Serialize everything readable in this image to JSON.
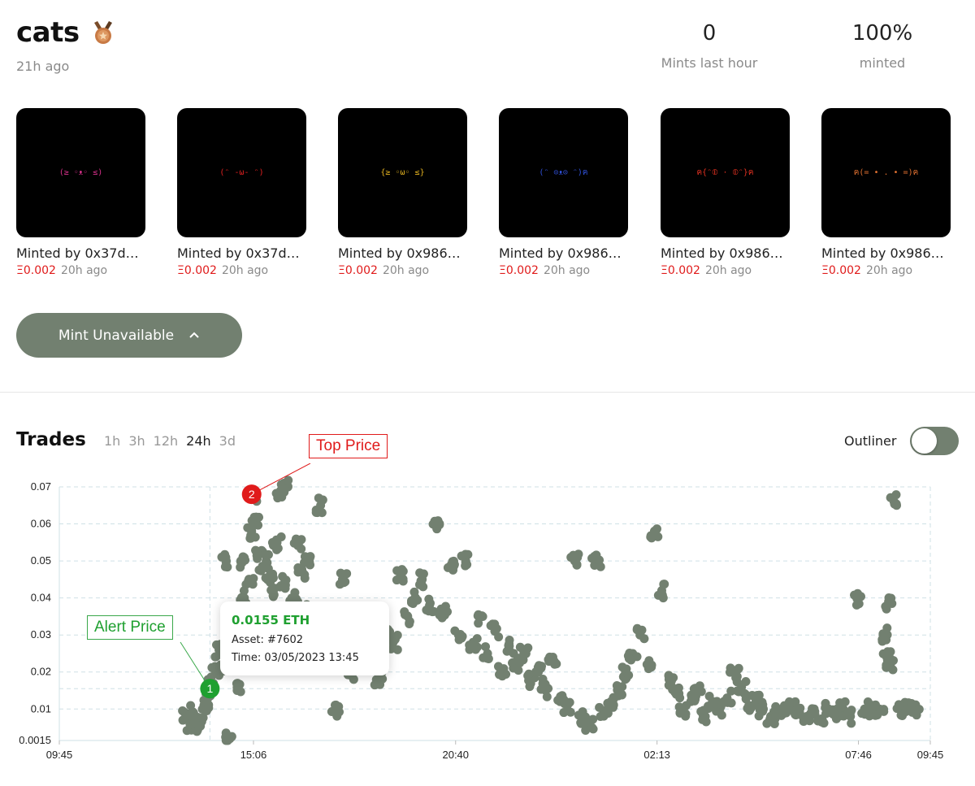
{
  "collection": {
    "name": "cats",
    "created": "21h ago",
    "medal_icon": "bronze-medal-icon"
  },
  "stats": [
    {
      "value": "0",
      "label": "Mints last hour"
    },
    {
      "value": "100%",
      "label": "minted"
    }
  ],
  "mints": [
    {
      "face": "(≥ ◦ᴥ◦ ≤)",
      "face_color": "#d6308a",
      "minted_by": "Minted by 0x37d4...",
      "price": "Ξ0.002",
      "time": "20h ago"
    },
    {
      "face": "(ᵔ -ω- ᵔ)",
      "face_color": "#e02020",
      "minted_by": "Minted by 0x37d4...",
      "price": "Ξ0.002",
      "time": "20h ago"
    },
    {
      "face": "{≥ ◦ω◦ ≤}",
      "face_color": "#e0b020",
      "minted_by": "Minted by 0x9860...",
      "price": "Ξ0.002",
      "time": "20h ago"
    },
    {
      "face": "(ᵔ ⊙ᴥ⊙ ᵔ)ฅ",
      "face_color": "#3050d8",
      "minted_by": "Minted by 0x9860...",
      "price": "Ξ0.002",
      "time": "20h ago"
    },
    {
      "face": "ฅ{ᵔ⦶ · ⦶ᵔ}ฅ",
      "face_color": "#e03020",
      "minted_by": "Minted by 0x9860...",
      "price": "Ξ0.002",
      "time": "20h ago"
    },
    {
      "face": "ฅ(= • . • =)ฅ",
      "face_color": "#e07030",
      "minted_by": "Minted by 0x9860...",
      "price": "Ξ0.002",
      "time": "20h ago"
    }
  ],
  "mint_button": {
    "label": "Mint Unavailable",
    "icon": "chevron-up-icon"
  },
  "trades": {
    "title": "Trades",
    "ranges": [
      "1h",
      "3h",
      "12h",
      "24h",
      "3d"
    ],
    "active_range": "24h",
    "outliner_label": "Outliner",
    "outliner_on": true
  },
  "tooltip": {
    "price": "0.0155 ETH",
    "asset": "Asset: #7602",
    "time": "Time: 03/05/2023 13:45"
  },
  "callouts": {
    "top_price": "Top Price",
    "alert_price": "Alert Price"
  },
  "markers": {
    "one": {
      "label": "1",
      "x_hours": 4.15,
      "y": 0.0155,
      "color": "#1fa030"
    },
    "two": {
      "label": "2",
      "x_hours": 5.3,
      "y": 0.068,
      "color": "#e01b1b"
    }
  },
  "chart_data": {
    "type": "scatter",
    "title": "",
    "xlabel": "",
    "ylabel": "",
    "x_unit": "hours since 09:45",
    "xlim": [
      0,
      24
    ],
    "ylim": [
      0.0015,
      0.07
    ],
    "x_tick_labels": [
      {
        "at": 0,
        "label": "09:45"
      },
      {
        "at": 5.35,
        "label": "15:06"
      },
      {
        "at": 10.92,
        "label": "20:40"
      },
      {
        "at": 16.47,
        "label": "02:13"
      },
      {
        "at": 22.02,
        "label": "07:46"
      },
      {
        "at": 24,
        "label": "09:45"
      }
    ],
    "y_ticks": [
      0.0015,
      0.01,
      0.02,
      0.03,
      0.04,
      0.05,
      0.06,
      0.07
    ],
    "y_tick_labels": [
      "0.0015",
      "0.01",
      "0.02",
      "0.03",
      "0.04",
      "0.05",
      "0.06",
      "0.07"
    ],
    "grid": true,
    "color": "#728070",
    "points": [
      [
        3.5,
        0.008
      ],
      [
        3.6,
        0.006
      ],
      [
        3.7,
        0.009
      ],
      [
        3.8,
        0.005
      ],
      [
        3.9,
        0.007
      ],
      [
        4.0,
        0.011
      ],
      [
        4.1,
        0.013
      ],
      [
        4.2,
        0.016
      ],
      [
        4.3,
        0.02
      ],
      [
        4.4,
        0.026
      ],
      [
        4.5,
        0.022
      ],
      [
        4.6,
        0.05
      ],
      [
        4.7,
        0.002
      ],
      [
        4.8,
        0.025
      ],
      [
        4.9,
        0.015
      ],
      [
        5.0,
        0.05
      ],
      [
        5.1,
        0.04
      ],
      [
        5.2,
        0.033
      ],
      [
        5.25,
        0.045
      ],
      [
        5.3,
        0.058
      ],
      [
        5.35,
        0.068
      ],
      [
        5.4,
        0.06
      ],
      [
        5.5,
        0.052
      ],
      [
        5.6,
        0.048
      ],
      [
        5.7,
        0.05
      ],
      [
        5.8,
        0.046
      ],
      [
        5.9,
        0.042
      ],
      [
        6.0,
        0.055
      ],
      [
        6.1,
        0.069
      ],
      [
        6.2,
        0.044
      ],
      [
        6.3,
        0.07
      ],
      [
        6.4,
        0.038
      ],
      [
        6.5,
        0.04
      ],
      [
        6.6,
        0.055
      ],
      [
        6.7,
        0.047
      ],
      [
        6.8,
        0.05
      ],
      [
        6.9,
        0.037
      ],
      [
        7.0,
        0.035
      ],
      [
        7.2,
        0.065
      ],
      [
        7.4,
        0.03
      ],
      [
        7.6,
        0.01
      ],
      [
        7.8,
        0.045
      ],
      [
        8.0,
        0.02
      ],
      [
        8.2,
        0.028
      ],
      [
        8.4,
        0.025
      ],
      [
        8.6,
        0.022
      ],
      [
        8.8,
        0.018
      ],
      [
        9.0,
        0.03
      ],
      [
        9.2,
        0.028
      ],
      [
        9.4,
        0.046
      ],
      [
        9.6,
        0.035
      ],
      [
        9.8,
        0.04
      ],
      [
        10.0,
        0.045
      ],
      [
        10.2,
        0.038
      ],
      [
        10.4,
        0.059
      ],
      [
        10.6,
        0.036
      ],
      [
        10.8,
        0.049
      ],
      [
        11.0,
        0.03
      ],
      [
        11.2,
        0.05
      ],
      [
        11.4,
        0.028
      ],
      [
        11.6,
        0.035
      ],
      [
        11.8,
        0.025
      ],
      [
        12.0,
        0.031
      ],
      [
        12.2,
        0.02
      ],
      [
        12.4,
        0.027
      ],
      [
        12.6,
        0.022
      ],
      [
        12.8,
        0.025
      ],
      [
        13.0,
        0.018
      ],
      [
        13.2,
        0.02
      ],
      [
        13.4,
        0.015
      ],
      [
        13.6,
        0.024
      ],
      [
        13.8,
        0.012
      ],
      [
        14.0,
        0.011
      ],
      [
        14.2,
        0.05
      ],
      [
        14.4,
        0.008
      ],
      [
        14.6,
        0.006
      ],
      [
        14.8,
        0.05
      ],
      [
        15.0,
        0.009
      ],
      [
        15.2,
        0.012
      ],
      [
        15.4,
        0.015
      ],
      [
        15.6,
        0.02
      ],
      [
        15.8,
        0.025
      ],
      [
        16.0,
        0.03
      ],
      [
        16.2,
        0.022
      ],
      [
        16.4,
        0.058
      ],
      [
        16.6,
        0.042
      ],
      [
        16.8,
        0.018
      ],
      [
        17.0,
        0.014
      ],
      [
        17.2,
        0.01
      ],
      [
        17.4,
        0.012
      ],
      [
        17.6,
        0.015
      ],
      [
        17.8,
        0.008
      ],
      [
        18.0,
        0.012
      ],
      [
        18.2,
        0.01
      ],
      [
        18.4,
        0.013
      ],
      [
        18.6,
        0.02
      ],
      [
        18.8,
        0.016
      ],
      [
        19.0,
        0.011
      ],
      [
        19.2,
        0.013
      ],
      [
        19.4,
        0.01
      ],
      [
        19.6,
        0.008
      ],
      [
        19.8,
        0.009
      ],
      [
        20.0,
        0.01
      ],
      [
        20.2,
        0.01
      ],
      [
        20.4,
        0.009
      ],
      [
        20.6,
        0.008
      ],
      [
        20.8,
        0.01
      ],
      [
        21.0,
        0.007
      ],
      [
        21.2,
        0.01
      ],
      [
        21.4,
        0.009
      ],
      [
        21.6,
        0.01
      ],
      [
        21.8,
        0.008
      ],
      [
        22.0,
        0.04
      ],
      [
        22.2,
        0.01
      ],
      [
        22.4,
        0.011
      ],
      [
        22.6,
        0.01
      ],
      [
        22.7,
        0.03
      ],
      [
        22.8,
        0.024
      ],
      [
        22.85,
        0.039
      ],
      [
        22.9,
        0.022
      ],
      [
        23.0,
        0.066
      ],
      [
        23.2,
        0.01
      ],
      [
        23.4,
        0.011
      ],
      [
        23.6,
        0.01
      ]
    ]
  }
}
